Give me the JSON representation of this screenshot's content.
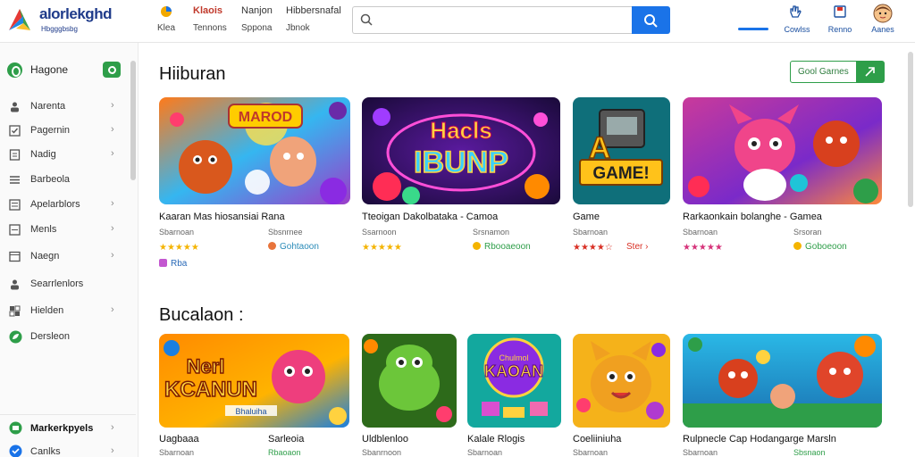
{
  "app": {
    "logo_text": "alorlekghd",
    "logo_sub": "Hbgggbsbg"
  },
  "topnav": [
    {
      "top": "Klaois",
      "bottom": "Klea"
    },
    {
      "top": "Nanjon",
      "bottom": "Tennons"
    },
    {
      "top": "Hibbersnafal",
      "bottom": "Sppona"
    }
  ],
  "topnav_extra": {
    "bottom": "Jbnok"
  },
  "search": {
    "value": "",
    "placeholder": ""
  },
  "top_right": [
    {
      "label": "",
      "icon": "hand-icon"
    },
    {
      "label": "Cowlss",
      "icon": "refresh-icon"
    },
    {
      "label": "Renno",
      "icon": "save-icon"
    },
    {
      "label": "Aanes",
      "icon": "avatar-icon"
    }
  ],
  "sidebar": {
    "home": "Hagone",
    "items": [
      {
        "label": "Narenta",
        "icon": "person-icon"
      },
      {
        "label": "Pagernin",
        "icon": "check-icon"
      },
      {
        "label": "Nadig",
        "icon": "doc-icon"
      },
      {
        "label": "Barbeola",
        "icon": "list-icon"
      },
      {
        "label": "Apelarblors",
        "icon": "list-icon"
      },
      {
        "label": "Menls",
        "icon": "doc-icon"
      },
      {
        "label": "Naegn",
        "icon": "window-icon"
      },
      {
        "label": "Searrlenlors",
        "icon": "person-icon"
      },
      {
        "label": "Hielden",
        "icon": "grid-icon"
      },
      {
        "label": "Dersleon",
        "icon": "leaf-icon"
      }
    ],
    "foot": [
      {
        "label": "Markerkpyels",
        "icon": "market-icon"
      },
      {
        "label": "Canlks",
        "icon": "shield-icon"
      }
    ]
  },
  "section1": {
    "title": "Hiiburan",
    "cta": "Gool Garnes",
    "cards": [
      {
        "title": "Kaaran Mas hiosansiai Rana",
        "sub": "Sbarnoan",
        "sub2": "Sbsnrnee",
        "stars": "★★★★★",
        "tag": "Gohtaoon",
        "tag2": "Rba"
      },
      {
        "title": "Tteoigan Dakolbataka - Camoa",
        "sub": "Ssarnoon",
        "sub2": "Srsnamon",
        "stars": "★★★★★",
        "tag": "Rbooaeoon",
        "tag2": ""
      },
      {
        "title": "Game",
        "sub": "Sbarnoan",
        "sub2": "",
        "stars": "★★★★☆",
        "tag": "Ster",
        "tag2": ""
      },
      {
        "title": "Rarkaonkain bolanghe - Gamea",
        "sub": "Sbarnoan",
        "sub2": "Srsoran",
        "stars": "★★★★★",
        "tag": "Goboeoon",
        "tag2": ""
      }
    ]
  },
  "section2": {
    "title": "Bucalaon :",
    "cards": [
      {
        "title": "Uagbaaa",
        "sub": "Sbarnoan",
        "sub2": "Sarleoia",
        "sub3": "Rbaoaon"
      },
      {
        "title": "Uldblenloo",
        "sub": "Sbanrnoon",
        "sub2": "",
        "sub3": ""
      },
      {
        "title": "Kalale Rlogis",
        "sub": "Sbarnoan",
        "sub2": "",
        "sub3": ""
      },
      {
        "title": "Coeliiniuha",
        "sub": "Sbarnoan",
        "sub2": "",
        "sub3": ""
      },
      {
        "title": "Rulpnecle Cap Hodangarge Marsln",
        "sub": "Sbarnoan",
        "sub2": "",
        "sub3": "Sbsnaon"
      }
    ]
  },
  "thumbs": {
    "s1_2_text_a": "Hacls",
    "s1_2_text_b": "IBUNP",
    "s1_3_text_a": "A",
    "s1_3_text_b": "GAME!",
    "s1_1_text": "MAROD",
    "s2_1_text_a": "Nerl",
    "s2_1_text_b": "KCANUN",
    "s2_1_text_c": "Bhaluiha",
    "s2_3_text_a": "Chulmol",
    "s2_3_text_b": "KAOAN"
  },
  "colors": {
    "accent": "#1a73e8",
    "green": "#2e9e49",
    "star": "#f4b400",
    "star_red": "#d93025"
  }
}
